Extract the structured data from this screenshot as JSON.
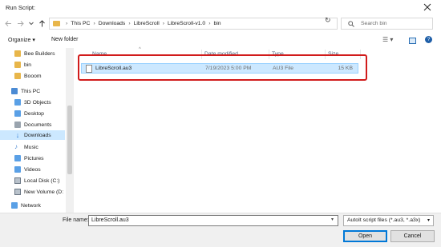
{
  "window": {
    "title": "Run Script:"
  },
  "address": {
    "crumbs": [
      "This PC",
      "Downloads",
      "LibreScroll",
      "LibreScroll-v1.0",
      "bin"
    ]
  },
  "search": {
    "placeholder": "Search bin"
  },
  "toolbar": {
    "organize": "Organize ▾",
    "new_folder": "New folder",
    "view": "☰ ▾"
  },
  "sidebar": {
    "items": [
      {
        "label": "Bee Builders",
        "icon": "folder-icon"
      },
      {
        "label": "bin",
        "icon": "folder-icon"
      },
      {
        "label": "Booom",
        "icon": "folder-icon"
      },
      {
        "label": "This PC",
        "icon": "pc-icon"
      },
      {
        "label": "3D Objects",
        "icon": "cube-icon"
      },
      {
        "label": "Desktop",
        "icon": "desktop-icon"
      },
      {
        "label": "Documents",
        "icon": "documents-icon"
      },
      {
        "label": "Downloads",
        "icon": "download-icon"
      },
      {
        "label": "Music",
        "icon": "music-icon"
      },
      {
        "label": "Pictures",
        "icon": "pictures-icon"
      },
      {
        "label": "Videos",
        "icon": "videos-icon"
      },
      {
        "label": "Local Disk (C:)",
        "icon": "disk-icon"
      },
      {
        "label": "New Volume (D:",
        "icon": "disk-icon"
      },
      {
        "label": "Network",
        "icon": "network-icon"
      }
    ]
  },
  "columns": {
    "name": "Name",
    "date": "Date modified",
    "type": "Type",
    "size": "Size"
  },
  "files": [
    {
      "name": "LibreScroll.au3",
      "date": "7/19/2023 5:00 PM",
      "type": "AU3 File",
      "size": "15 KB"
    }
  ],
  "footer": {
    "filename_label": "File name:",
    "filename_value": "LibreScroll.au3",
    "filetype": "AutoIt script files (*.au3, *.a3x)",
    "open": "Open",
    "cancel": "Cancel"
  }
}
